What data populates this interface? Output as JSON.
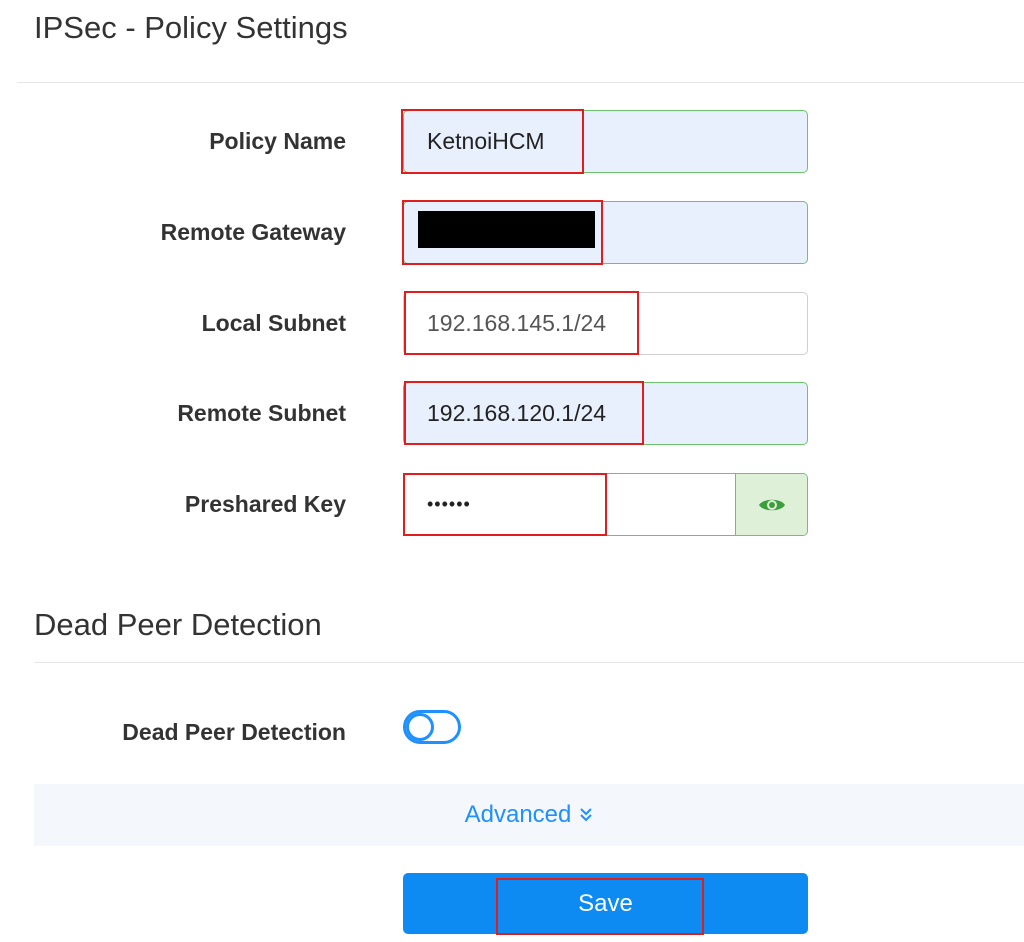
{
  "policy": {
    "title": "IPSec - Policy Settings",
    "fields": {
      "policy_name": {
        "label": "Policy Name",
        "value": "KetnoiHCM"
      },
      "remote_gateway": {
        "label": "Remote Gateway",
        "value": ""
      },
      "local_subnet": {
        "label": "Local Subnet",
        "value": "192.168.145.1/24"
      },
      "remote_subnet": {
        "label": "Remote Subnet",
        "value": "192.168.120.1/24"
      },
      "preshared_key": {
        "label": "Preshared Key",
        "value": "••••••"
      }
    }
  },
  "dpd": {
    "title": "Dead Peer Detection",
    "label": "Dead Peer Detection",
    "enabled": false
  },
  "advanced": {
    "label": "Advanced"
  },
  "actions": {
    "save_label": "Save"
  },
  "colors": {
    "accent": "#1e90ff",
    "save_button": "#0d8bf2",
    "filled_input": "#e8f0fe",
    "valid_border": "#6cc36c",
    "highlight": "#e01e1e"
  },
  "icons": {
    "password_toggle": "eye-icon",
    "advanced_toggle": "double-chevron-down-icon"
  }
}
